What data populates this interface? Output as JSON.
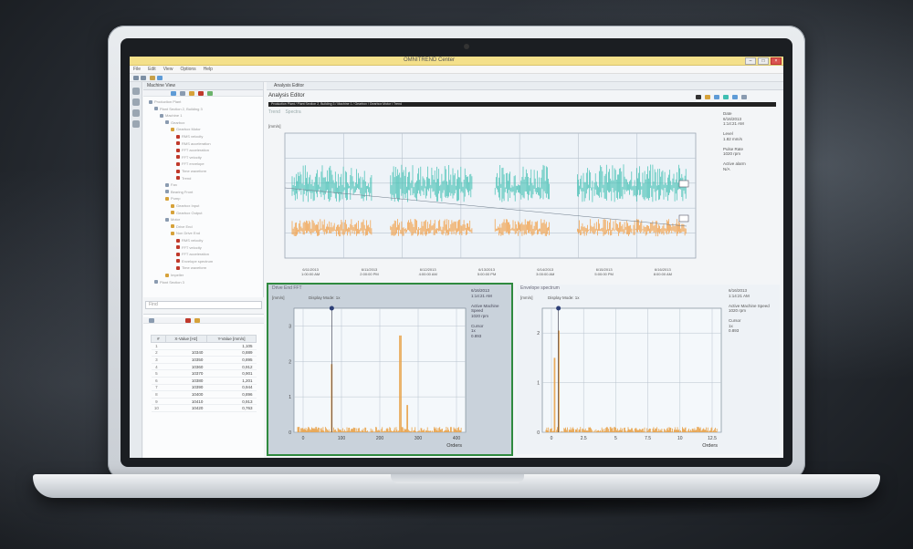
{
  "window": {
    "title": "OMNITREND Center",
    "buttons": [
      "–",
      "□",
      "×"
    ]
  },
  "menu": [
    "File",
    "Edit",
    "View",
    "Options",
    "Help"
  ],
  "tree": {
    "tab_label": "Machine View",
    "items": [
      {
        "label": "Production Plant",
        "depth": 0,
        "color": "#8a9bb0"
      },
      {
        "label": "Plant Section 2, Building 3",
        "depth": 1,
        "color": "#8a9bb0"
      },
      {
        "label": "Machine 1",
        "depth": 2,
        "color": "#8a9bb0"
      },
      {
        "label": "Gearbox",
        "depth": 3,
        "color": "#8a9bb0"
      },
      {
        "label": "Gearbox Motor",
        "depth": 4,
        "color": "#d6a23a"
      },
      {
        "label": "RMS velocity",
        "depth": 5,
        "color": "#c0392b"
      },
      {
        "label": "RMS acceleration",
        "depth": 5,
        "color": "#c0392b"
      },
      {
        "label": "FFT acceleration",
        "depth": 5,
        "color": "#c0392b"
      },
      {
        "label": "FFT velocity",
        "depth": 5,
        "color": "#c0392b"
      },
      {
        "label": "FFT envelope",
        "depth": 5,
        "color": "#c0392b"
      },
      {
        "label": "Time waveform",
        "depth": 5,
        "color": "#c0392b"
      },
      {
        "label": "Trend",
        "depth": 5,
        "color": "#c0392b"
      },
      {
        "label": "Fan",
        "depth": 3,
        "color": "#8a9bb0"
      },
      {
        "label": "Bearing Front",
        "depth": 3,
        "color": "#8a9bb0"
      },
      {
        "label": "Pump",
        "depth": 3,
        "color": "#d6a23a"
      },
      {
        "label": "Gearbox Input",
        "depth": 4,
        "color": "#d6a23a"
      },
      {
        "label": "Gearbox Output",
        "depth": 4,
        "color": "#d6a23a"
      },
      {
        "label": "Motor",
        "depth": 3,
        "color": "#8a9bb0"
      },
      {
        "label": "Drive End",
        "depth": 4,
        "color": "#d6a23a"
      },
      {
        "label": "Non Drive End",
        "depth": 4,
        "color": "#d6a23a"
      },
      {
        "label": "RMS velocity",
        "depth": 5,
        "color": "#c0392b"
      },
      {
        "label": "FFT velocity",
        "depth": 5,
        "color": "#c0392b"
      },
      {
        "label": "FFT acceleration",
        "depth": 5,
        "color": "#c0392b"
      },
      {
        "label": "Envelope spectrum",
        "depth": 5,
        "color": "#c0392b"
      },
      {
        "label": "Time waveform",
        "depth": 5,
        "color": "#c0392b"
      },
      {
        "label": "Impeller",
        "depth": 3,
        "color": "#d6a23a"
      },
      {
        "label": "Plant Section 3",
        "depth": 1,
        "color": "#8a9bb0"
      }
    ]
  },
  "search": {
    "placeholder": "Find"
  },
  "table": {
    "headers": [
      "#",
      "X-Value [Hz]",
      "Y-Value [mm/s]"
    ],
    "rows": [
      [
        "1",
        "",
        "1,105"
      ],
      [
        "2",
        "10340",
        "0,889"
      ],
      [
        "3",
        "10350",
        "0,895"
      ],
      [
        "4",
        "10360",
        "0,912"
      ],
      [
        "5",
        "10370",
        "0,901"
      ],
      [
        "6",
        "10380",
        "1,201"
      ],
      [
        "7",
        "10390",
        "0,944"
      ],
      [
        "8",
        "10400",
        "0,896"
      ],
      [
        "9",
        "10410",
        "0,913"
      ],
      [
        "10",
        "10420",
        "0,763"
      ]
    ]
  },
  "main": {
    "tab_label": "Analysis Editor",
    "editor_title": "Analysis Editor",
    "path": "Production Plant / Plant Section 2, Building 3 / Machine 1 / Gearbox / Gearbox Motor / Trend",
    "sub_tabs": [
      "Trend",
      "Spectra"
    ],
    "unit_label": "[mm/s]"
  },
  "trend_info": [
    "Date",
    "6/16/2013",
    "1:14:21 AM",
    "",
    "Level",
    "1.82 mm/s",
    "",
    "Pulse Rate",
    "1020 rpm",
    "",
    "Active alarm",
    "N/A"
  ],
  "date_labels": [
    [
      "6/11/2013",
      "1:00:00 AM"
    ],
    [
      "6/11/2013",
      "2:00:00 PM"
    ],
    [
      "6/12/2013",
      "4:00:00 AM"
    ],
    [
      "6/13/2013",
      "5:00:00 PM"
    ],
    [
      "6/14/2013",
      "3:00:00 AM"
    ],
    [
      "6/15/2013",
      "5:00:00 PM"
    ],
    [
      "6/16/2013",
      "8:00:00 AM"
    ]
  ],
  "spectrum_left": {
    "header": "Drive End FFT",
    "unit": "[mm/s]",
    "cursor_label": "Display Mode: 1x",
    "info": [
      "6/16/2013",
      "1:14:21 AM",
      "",
      "Active Machine Speed",
      "1020 rpm",
      "",
      "Cursor",
      "1x",
      "0.893"
    ],
    "x_ticks": [
      "0",
      "100",
      "200",
      "300",
      "400"
    ],
    "x_axis_label": "Orders",
    "y_ticks": [
      "0",
      "1",
      "2",
      "3"
    ]
  },
  "spectrum_right": {
    "header": "Envelope spectrum",
    "unit": "[mm/s]",
    "cursor_label": "Display Mode: 1x",
    "info": [
      "6/16/2013",
      "1:14:21 AM",
      "",
      "Active Machine Speed",
      "1020 rpm",
      "",
      "Cursor",
      "1x",
      "0.893"
    ],
    "x_ticks": [
      "0",
      "2.5",
      "5",
      "7.5",
      "10",
      "12.5"
    ],
    "x_axis_label": "Orders",
    "y_ticks": [
      "0",
      "1",
      "2"
    ]
  },
  "colors": {
    "teal": "#3fbfb2",
    "orange": "#f29a3c",
    "selected_border": "#2f8a3f",
    "spectrum_line": "#e8a24a"
  }
}
